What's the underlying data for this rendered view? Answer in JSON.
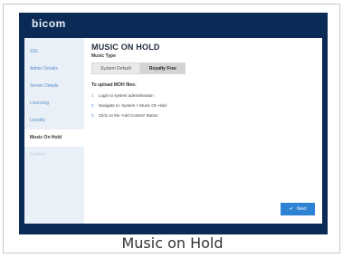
{
  "app": {
    "logo_text": "bicom"
  },
  "sidebar": {
    "items": [
      {
        "label": "SSL",
        "state": "done"
      },
      {
        "label": "Admin Details",
        "state": "done"
      },
      {
        "label": "Server Details",
        "state": "done"
      },
      {
        "label": "Licensing",
        "state": "done"
      },
      {
        "label": "Locality",
        "state": "done"
      },
      {
        "label": "Music On Hold",
        "state": "active"
      },
      {
        "label": "Confirm",
        "state": "pending"
      }
    ]
  },
  "main": {
    "title": "MUSIC ON HOLD",
    "music_type_label": "Music Type",
    "music_type_options": [
      "System Default",
      "Royalty Free"
    ],
    "music_type_selected": "Royalty Free",
    "upload_heading": "To upload MOH files:",
    "steps": [
      {
        "num": "1",
        "text": "Login to system administration"
      },
      {
        "num": "2",
        "text": "Navigate to: System > Music On Hold"
      },
      {
        "num": "3",
        "text": "Click on the 'Add Content' Button"
      }
    ],
    "next_label": "Next",
    "next_icon": "check-icon"
  },
  "caption": "Music on Hold",
  "colors": {
    "topbar": "#0b2a55",
    "accent": "#2f83d4",
    "sidebar_bg": "#eaf0f7"
  }
}
